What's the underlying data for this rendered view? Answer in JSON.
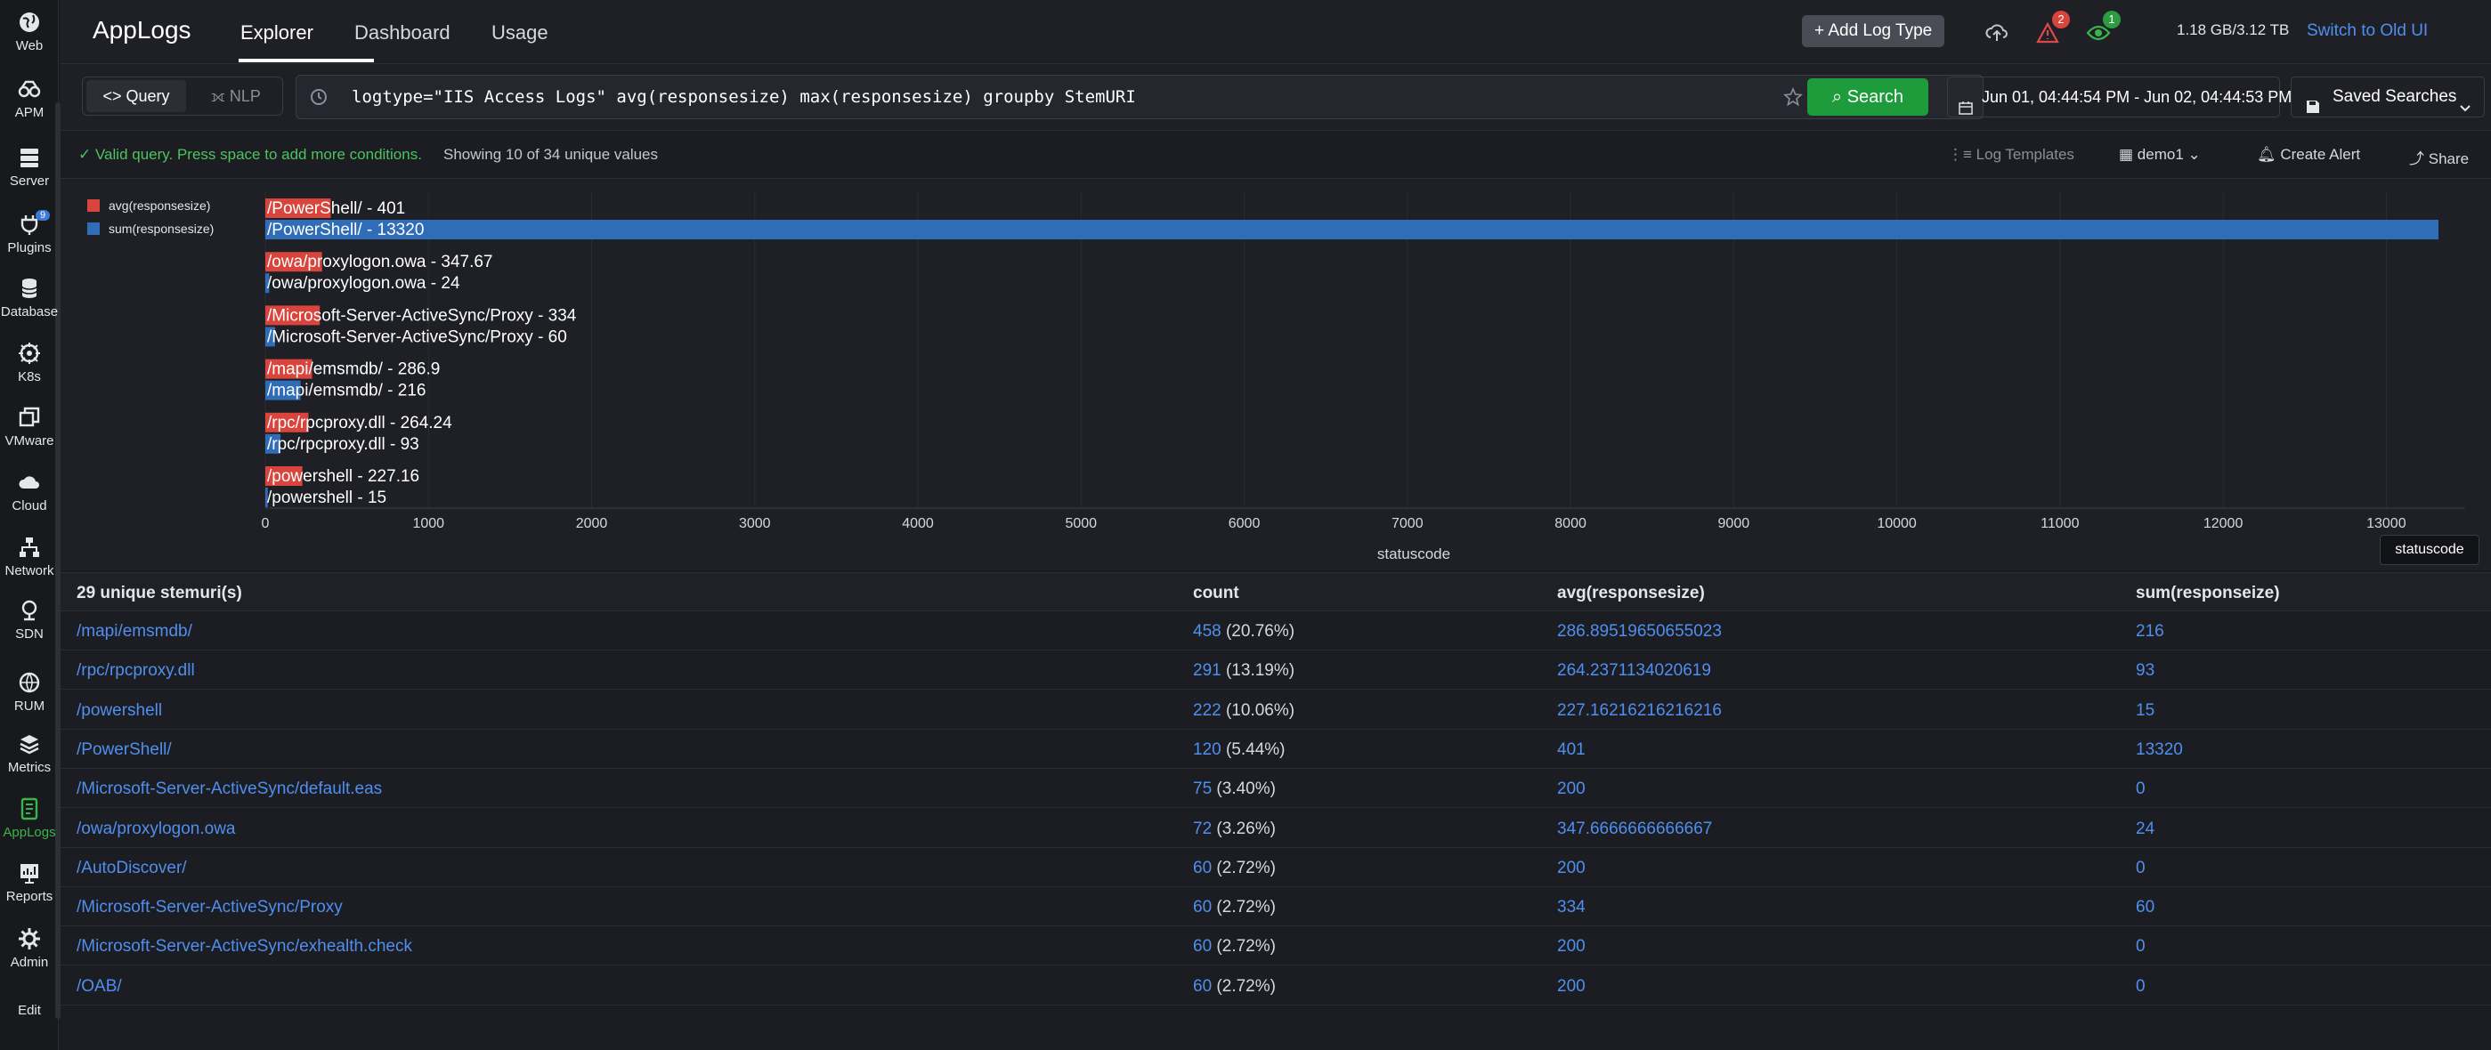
{
  "rail": [
    {
      "label": "Web",
      "icon": "globe-icon"
    },
    {
      "label": "APM",
      "icon": "binoculars-icon"
    },
    {
      "label": "Server",
      "icon": "server-icon"
    },
    {
      "label": "Plugins",
      "icon": "plug-icon",
      "badge": "9"
    },
    {
      "label": "Database",
      "icon": "database-icon"
    },
    {
      "label": "K8s",
      "icon": "helm-icon"
    },
    {
      "label": "VMware",
      "icon": "vm-icon"
    },
    {
      "label": "Cloud",
      "icon": "cloud-icon"
    },
    {
      "label": "Network",
      "icon": "network-icon"
    },
    {
      "label": "SDN",
      "icon": "sdn-icon"
    },
    {
      "label": "RUM",
      "icon": "rum-icon"
    },
    {
      "label": "Metrics",
      "icon": "layers-icon"
    },
    {
      "label": "AppLogs",
      "icon": "applogs-icon",
      "active": true
    },
    {
      "label": "Reports",
      "icon": "reports-icon"
    },
    {
      "label": "Admin",
      "icon": "gear-icon"
    },
    {
      "label": "Edit",
      "icon": ""
    }
  ],
  "header": {
    "title": "AppLogs",
    "tabs": [
      "Explorer",
      "Dashboard",
      "Usage"
    ],
    "add_log_type": "+ Add Log Type",
    "alerts_badge": "2",
    "watch_badge": "1",
    "storage": "1.18 GB/3.12 TB",
    "switch_old": "Switch to Old UI"
  },
  "query": {
    "mode_query": "<> Query",
    "mode_nlp": "NLP",
    "text": "logtype=\"IIS Access Logs\" avg(responsesize) max(responsesize) groupby StemURI",
    "search_label": "Search",
    "date_range": "Jun 01, 04:44:54 PM - Jun 02, 04:44:53 PM",
    "saved_searches": "Saved Searches"
  },
  "status": {
    "valid_msg": "Valid query. Press space to add more conditions.",
    "showing": "Showing 10 of 34 unique values",
    "log_templates": "Log Templates",
    "user": "demo1",
    "create_alert": "Create Alert",
    "share": "Share"
  },
  "colors": {
    "avg": "#d9453c",
    "sum": "#2f6db8",
    "accent": "#4f8fef",
    "success": "#1e9b3a"
  },
  "chart_data": {
    "type": "bar",
    "orientation": "horizontal",
    "xlabel": "statuscode",
    "xlim": [
      0,
      13320
    ],
    "xticks": [
      0,
      1000,
      2000,
      3000,
      4000,
      5000,
      6000,
      7000,
      8000,
      9000,
      10000,
      11000,
      12000,
      13000
    ],
    "legend_position": "top-left",
    "series": [
      {
        "name": "avg(responsesize)",
        "color": "#d9453c"
      },
      {
        "name": "sum(responsesize)",
        "color": "#2f6db8"
      }
    ],
    "groups": [
      {
        "category": "/PowerShell/",
        "avg": 401,
        "sum": 13320,
        "avg_label": "/PowerShell/ - 401",
        "sum_label": "/PowerShell/ - 13320"
      },
      {
        "category": "/owa/proxylogon.owa",
        "avg": 347.67,
        "sum": 24,
        "avg_label": "/owa/proxylogon.owa - 347.67",
        "sum_label": "/owa/proxylogon.owa - 24"
      },
      {
        "category": "/Microsoft-Server-ActiveSync/Proxy",
        "avg": 334,
        "sum": 60,
        "avg_label": "/Microsoft-Server-ActiveSync/Proxy - 334",
        "sum_label": "/Microsoft-Server-ActiveSync/Proxy - 60"
      },
      {
        "category": "/mapi/emsmdb/",
        "avg": 286.9,
        "sum": 216,
        "avg_label": "/mapi/emsmdb/ - 286.9",
        "sum_label": "/mapi/emsmdb/ - 216"
      },
      {
        "category": "/rpc/rpcproxy.dll",
        "avg": 264.24,
        "sum": 93,
        "avg_label": "/rpc/rpcproxy.dll - 264.24",
        "sum_label": "/rpc/rpcproxy.dll - 93"
      },
      {
        "category": "/powershell",
        "avg": 227.16,
        "sum": 15,
        "avg_label": "/powershell - 227.16",
        "sum_label": "/powershell - 15"
      }
    ],
    "tooltip": "statuscode"
  },
  "table": {
    "headers": [
      "29 unique stemuri(s)",
      "count",
      "avg(responsesize)",
      "sum(responseize)"
    ],
    "rows": [
      {
        "uri": "/mapi/emsmdb/",
        "count": "458",
        "pct": "(20.76%)",
        "avg": "286.89519650655023",
        "sum": "216"
      },
      {
        "uri": "/rpc/rpcproxy.dll",
        "count": "291",
        "pct": "(13.19%)",
        "avg": "264.2371134020619",
        "sum": "93"
      },
      {
        "uri": "/powershell",
        "count": "222",
        "pct": "(10.06%)",
        "avg": "227.16216216216216",
        "sum": "15"
      },
      {
        "uri": "/PowerShell/",
        "count": "120",
        "pct": "(5.44%)",
        "avg": "401",
        "sum": "13320"
      },
      {
        "uri": "/Microsoft-Server-ActiveSync/default.eas",
        "count": "75",
        "pct": "(3.40%)",
        "avg": "200",
        "sum": "0"
      },
      {
        "uri": "/owa/proxylogon.owa",
        "count": "72",
        "pct": "(3.26%)",
        "avg": "347.6666666666667",
        "sum": "24"
      },
      {
        "uri": "/AutoDiscover/",
        "count": "60",
        "pct": "(2.72%)",
        "avg": "200",
        "sum": "0"
      },
      {
        "uri": "/Microsoft-Server-ActiveSync/Proxy",
        "count": "60",
        "pct": "(2.72%)",
        "avg": "334",
        "sum": "60"
      },
      {
        "uri": "/Microsoft-Server-ActiveSync/exhealth.check",
        "count": "60",
        "pct": "(2.72%)",
        "avg": "200",
        "sum": "0"
      },
      {
        "uri": "/OAB/",
        "count": "60",
        "pct": "(2.72%)",
        "avg": "200",
        "sum": "0"
      }
    ]
  }
}
